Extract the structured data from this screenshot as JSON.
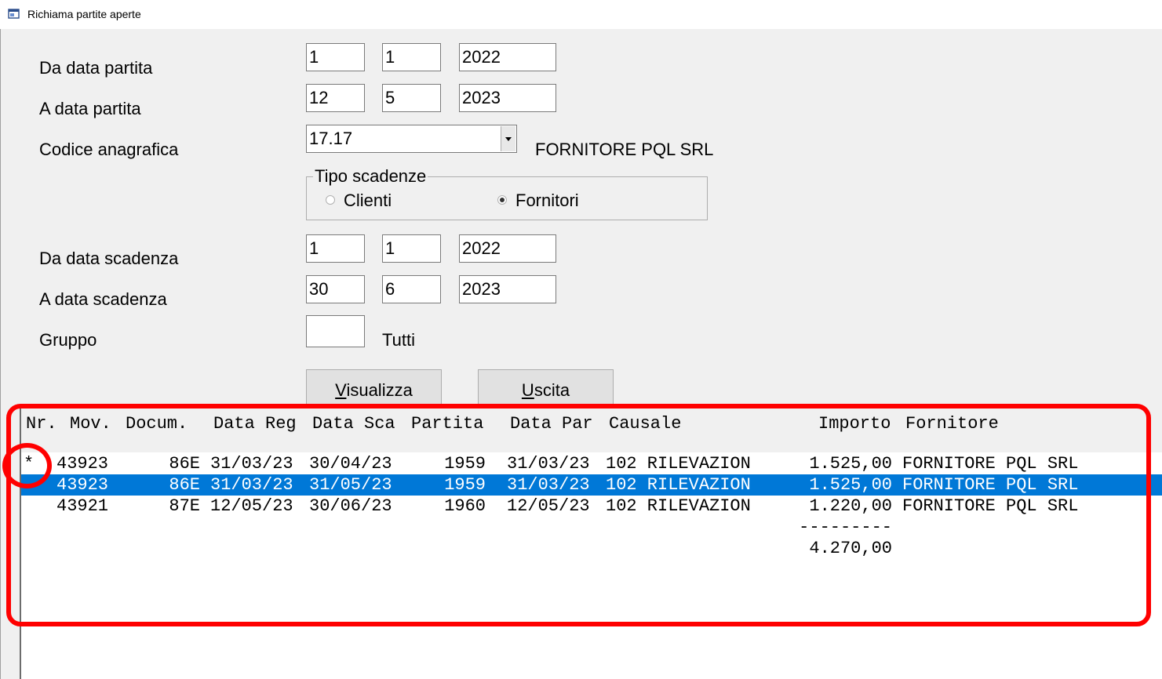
{
  "window": {
    "title": "Richiama partite aperte",
    "icon": "window-icon"
  },
  "form": {
    "da_data_partita": {
      "label": "Da data partita",
      "day": "1",
      "month": "1",
      "year": "2022"
    },
    "a_data_partita": {
      "label": "A data partita",
      "day": "12",
      "month": "5",
      "year": "2023"
    },
    "codice_anagrafica": {
      "label": "Codice anagrafica",
      "value": "17.17",
      "description": "FORNITORE PQL SRL"
    },
    "tipo_scadenze": {
      "legend": "Tipo scadenze",
      "options": [
        {
          "label": "Clienti",
          "checked": false
        },
        {
          "label": "Fornitori",
          "checked": true
        }
      ]
    },
    "da_data_scadenza": {
      "label": "Da data scadenza",
      "day": "1",
      "month": "1",
      "year": "2022"
    },
    "a_data_scadenza": {
      "label": "A data scadenza",
      "day": "30",
      "month": "6",
      "year": "2023"
    },
    "gruppo": {
      "label": "Gruppo",
      "value": "",
      "description": "Tutti"
    }
  },
  "buttons": {
    "visualizza": {
      "accel": "V",
      "rest": "isualizza"
    },
    "uscita": {
      "accel": "U",
      "rest": "scita"
    }
  },
  "grid": {
    "headers": [
      "Nr.",
      "Mov.",
      "Docum.",
      "Data Reg",
      "Data Sca",
      "Partita",
      "Data Par",
      "Causale",
      "Importo",
      "Fornitore"
    ],
    "rows": [
      {
        "marker": "*",
        "mov": "43923",
        "docum": "86E",
        "data_reg": "31/03/23",
        "data_sca": "30/04/23",
        "partita": "1959",
        "data_par": "31/03/23",
        "causale": "102 RILEVAZION",
        "importo": "1.525,00",
        "fornitore": "FORNITORE PQL SRL",
        "selected": false
      },
      {
        "marker": "",
        "mov": "43923",
        "docum": "86E",
        "data_reg": "31/03/23",
        "data_sca": "31/05/23",
        "partita": "1959",
        "data_par": "31/03/23",
        "causale": "102 RILEVAZION",
        "importo": "1.525,00",
        "fornitore": "FORNITORE PQL SRL",
        "selected": true
      },
      {
        "marker": "",
        "mov": "43921",
        "docum": "87E",
        "data_reg": "12/05/23",
        "data_sca": "30/06/23",
        "partita": "1960",
        "data_par": "12/05/23",
        "causale": "102 RILEVAZION",
        "importo": "1.220,00",
        "fornitore": "FORNITORE PQL SRL",
        "selected": false
      }
    ],
    "separator": "---------",
    "total": "4.270,00"
  },
  "annotations": {
    "color": "#ff0000"
  }
}
